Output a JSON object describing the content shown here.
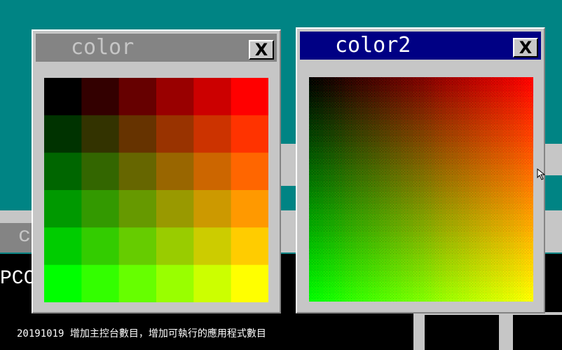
{
  "windows": [
    {
      "title": "color",
      "active": false,
      "close_label": "X"
    },
    {
      "title": "color2",
      "active": true,
      "close_label": "X"
    }
  ],
  "background_window": {
    "title_fragment": "c",
    "text_fragment": "PCC"
  },
  "grid": {
    "rows": 6,
    "cols": 6,
    "red_axis": "left-to-right",
    "green_axis": "top-to-bottom"
  },
  "status_text": "20191019 增加主控台數目，增加可執行的應用程式數目",
  "colors": {
    "desktop": "#008484",
    "window_face": "#c6c6c6",
    "active_title": "#000084",
    "inactive_title": "#848484",
    "active_title_text": "#ffffff",
    "inactive_title_text": "#c6c6c6"
  }
}
